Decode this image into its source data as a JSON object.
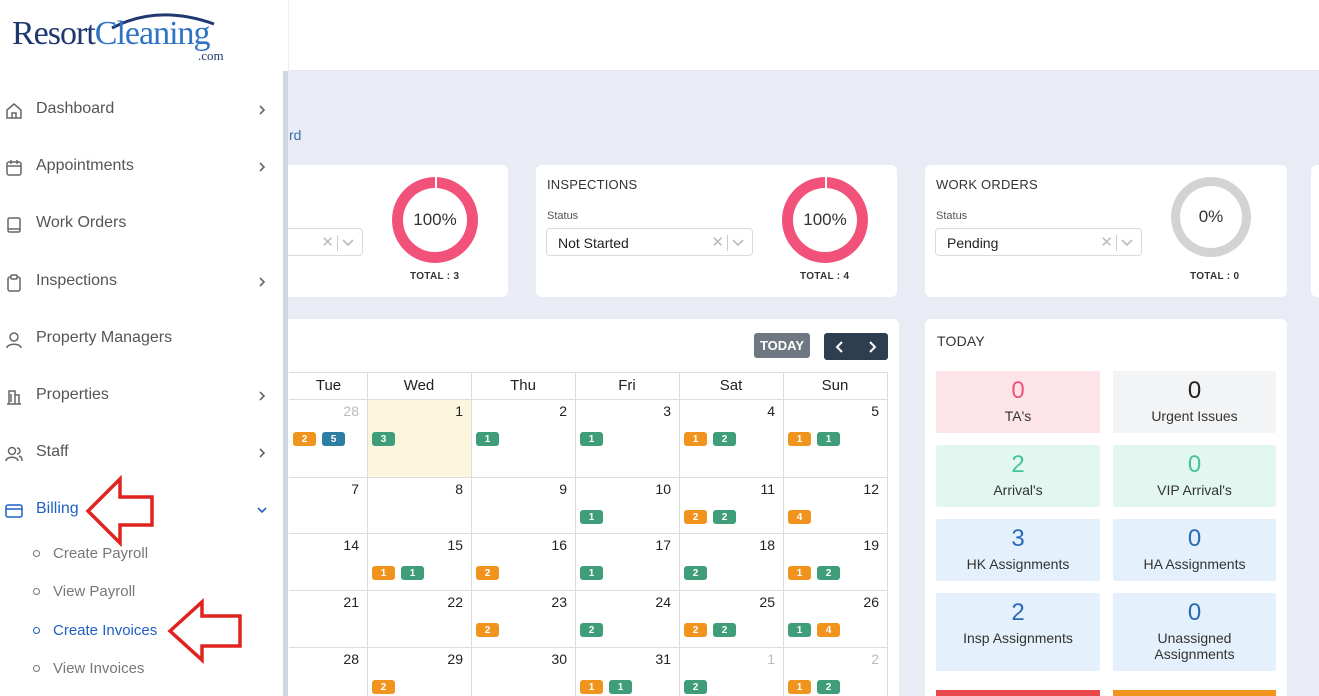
{
  "brand": {
    "logo_part1": "Resort",
    "logo_part2": "Cleaning",
    "logo_suffix": ".com"
  },
  "breadcrumb_fragment": "rd",
  "cards": [
    {
      "title": "",
      "status_label": "",
      "status_value": "",
      "percent": "100%",
      "total": "TOTAL : 3",
      "ring_color": "#f2527a",
      "fill": 1.0
    },
    {
      "title": "INSPECTIONS",
      "status_label": "Status",
      "status_value": "Not Started",
      "percent": "100%",
      "total": "TOTAL : 4",
      "ring_color": "#f2527a",
      "fill": 1.0
    },
    {
      "title": "WORK ORDERS",
      "status_label": "Status",
      "status_value": "Pending",
      "percent": "0%",
      "total": "TOTAL : 0",
      "ring_color": "#d3d3d3",
      "fill": 0.0
    }
  ],
  "calendar": {
    "today_label": "TODAY",
    "days": [
      "Tue",
      "Wed",
      "Thu",
      "Fri",
      "Sat",
      "Sun"
    ],
    "weeks": [
      [
        {
          "d": "28",
          "muted": true,
          "b": [
            [
              "2",
              "o"
            ],
            [
              "5",
              "b"
            ]
          ]
        },
        {
          "d": "1",
          "today": true,
          "b": [
            [
              "3",
              "g"
            ]
          ]
        },
        {
          "d": "2",
          "b": [
            [
              "1",
              "g"
            ]
          ]
        },
        {
          "d": "3",
          "b": [
            [
              "1",
              "g"
            ]
          ]
        },
        {
          "d": "4",
          "b": [
            [
              "1",
              "o"
            ],
            [
              "2",
              "g"
            ]
          ]
        },
        {
          "d": "5",
          "b": [
            [
              "1",
              "o"
            ],
            [
              "1",
              "g"
            ]
          ]
        }
      ],
      [
        {
          "d": "7",
          "b": []
        },
        {
          "d": "8",
          "b": []
        },
        {
          "d": "9",
          "b": []
        },
        {
          "d": "10",
          "b": [
            [
              "1",
              "g"
            ]
          ]
        },
        {
          "d": "11",
          "b": [
            [
              "2",
              "o"
            ],
            [
              "2",
              "g"
            ]
          ]
        },
        {
          "d": "12",
          "b": [
            [
              "4",
              "o"
            ]
          ]
        }
      ],
      [
        {
          "d": "14",
          "b": []
        },
        {
          "d": "15",
          "b": [
            [
              "1",
              "o"
            ],
            [
              "1",
              "g"
            ]
          ]
        },
        {
          "d": "16",
          "b": [
            [
              "2",
              "o"
            ]
          ]
        },
        {
          "d": "17",
          "b": [
            [
              "1",
              "g"
            ]
          ]
        },
        {
          "d": "18",
          "b": [
            [
              "2",
              "g"
            ]
          ]
        },
        {
          "d": "19",
          "b": [
            [
              "1",
              "o"
            ],
            [
              "2",
              "g"
            ]
          ]
        }
      ],
      [
        {
          "d": "21",
          "b": []
        },
        {
          "d": "22",
          "b": []
        },
        {
          "d": "23",
          "b": [
            [
              "2",
              "o"
            ]
          ]
        },
        {
          "d": "24",
          "b": [
            [
              "2",
              "g"
            ]
          ]
        },
        {
          "d": "25",
          "b": [
            [
              "2",
              "o"
            ],
            [
              "2",
              "g"
            ]
          ]
        },
        {
          "d": "26",
          "b": [
            [
              "1",
              "g"
            ],
            [
              "4",
              "o"
            ]
          ]
        }
      ],
      [
        {
          "d": "28",
          "b": []
        },
        {
          "d": "29",
          "b": [
            [
              "2",
              "o"
            ]
          ]
        },
        {
          "d": "30",
          "b": []
        },
        {
          "d": "31",
          "b": [
            [
              "1",
              "o"
            ],
            [
              "1",
              "g"
            ]
          ]
        },
        {
          "d": "1",
          "muted": true,
          "b": [
            [
              "2",
              "g"
            ]
          ]
        },
        {
          "d": "2",
          "muted": true,
          "b": [
            [
              "1",
              "o"
            ],
            [
              "2",
              "g"
            ]
          ]
        }
      ]
    ]
  },
  "today_panel": {
    "title": "TODAY",
    "tiles": [
      {
        "num": "0",
        "label": "TA's",
        "bg": "#fde4e8",
        "color": "#f2527a"
      },
      {
        "num": "0",
        "label": "Urgent Issues",
        "bg": "#f3f4f6",
        "color": "#222222"
      },
      {
        "num": "2",
        "label": "Arrival's",
        "bg": "#e3f7f1",
        "color": "#45c49a"
      },
      {
        "num": "0",
        "label": "VIP Arrival's",
        "bg": "#e3f7f1",
        "color": "#45c49a"
      },
      {
        "num": "3",
        "label": "HK Assignments",
        "bg": "#e4f0fb",
        "color": "#2a6bb8"
      },
      {
        "num": "0",
        "label": "HA Assignments",
        "bg": "#e4f0fb",
        "color": "#2a6bb8"
      },
      {
        "num": "2",
        "label": "Insp Assignments",
        "bg": "#e4f0fb",
        "color": "#2a6bb8"
      },
      {
        "num": "0",
        "label": "Unassigned Assignments",
        "bg": "#e4f0fb",
        "color": "#2a6bb8"
      }
    ]
  },
  "sidebar": {
    "items": [
      {
        "label": "Dashboard",
        "icon": "home-icon",
        "chevron": "right"
      },
      {
        "label": "Appointments",
        "icon": "calendar-icon",
        "chevron": "right"
      },
      {
        "label": "Work Orders",
        "icon": "book-icon",
        "chevron": ""
      },
      {
        "label": "Inspections",
        "icon": "clipboard-icon",
        "chevron": "right"
      },
      {
        "label": "Property Managers",
        "icon": "user-icon",
        "chevron": ""
      },
      {
        "label": "Properties",
        "icon": "building-icon",
        "chevron": "right"
      },
      {
        "label": "Staff",
        "icon": "users-icon",
        "chevron": "right"
      },
      {
        "label": "Billing",
        "icon": "credit-card-icon",
        "chevron": "down",
        "active": true
      }
    ],
    "sub_items": [
      {
        "label": "Create Payroll"
      },
      {
        "label": "View Payroll"
      },
      {
        "label": "Create Invoices",
        "active": true
      },
      {
        "label": "View Invoices"
      }
    ]
  }
}
